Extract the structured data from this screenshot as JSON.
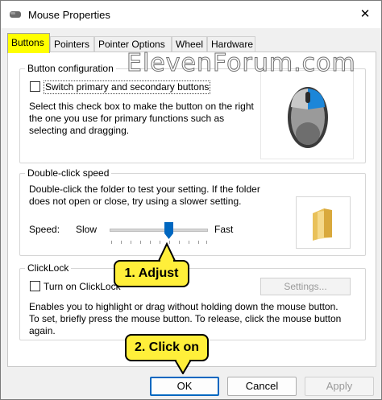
{
  "window": {
    "title": "Mouse Properties",
    "close_glyph": "✕"
  },
  "tabs": [
    {
      "label": "Buttons",
      "active": true
    },
    {
      "label": "Pointers",
      "active": false
    },
    {
      "label": "Pointer Options",
      "active": false
    },
    {
      "label": "Wheel",
      "active": false
    },
    {
      "label": "Hardware",
      "active": false
    }
  ],
  "watermark": "ElevenForum.com",
  "button_configuration": {
    "title": "Button configuration",
    "checkbox_label": "Switch primary and secondary buttons",
    "checked": false,
    "description": "Select this check box to make the button on the right the one you use for primary functions such as selecting and dragging."
  },
  "double_click": {
    "title": "Double-click speed",
    "description": "Double-click the folder to test your setting. If the folder does not open or close, try using a slower setting.",
    "speed_label": "Speed:",
    "slow_label": "Slow",
    "fast_label": "Fast",
    "slider_value": 0.6
  },
  "clicklock": {
    "title": "ClickLock",
    "checkbox_label": "Turn on ClickLock",
    "checked": false,
    "settings_button": "Settings...",
    "description": "Enables you to highlight or drag without holding down the mouse button. To set, briefly press the mouse button. To release, click the mouse button again."
  },
  "footer": {
    "ok": "OK",
    "cancel": "Cancel",
    "apply": "Apply"
  },
  "callouts": {
    "step1": "1. Adjust",
    "step2": "2. Click on"
  },
  "colors": {
    "highlight": "#ffff00",
    "callout": "#ffef3a",
    "accent": "#0067c0"
  }
}
